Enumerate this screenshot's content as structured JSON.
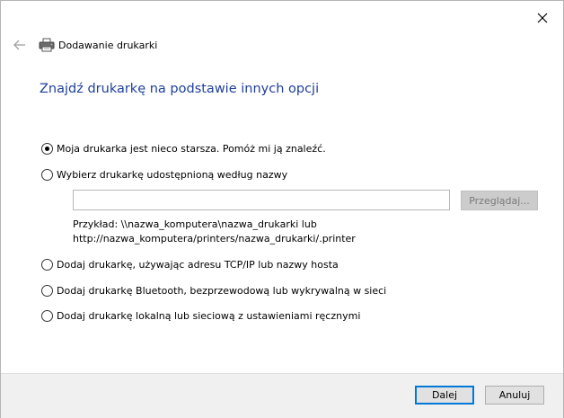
{
  "window": {
    "title": "Dodawanie drukarki",
    "close_icon": "close-icon",
    "back_icon": "back-arrow-icon",
    "printer_icon": "printer-icon"
  },
  "heading": "Znajdź drukarkę na podstawie innych opcji",
  "options": [
    {
      "label": "Moja drukarka jest nieco starsza. Pomóż mi ją znaleźć.",
      "checked": true
    },
    {
      "label": "Wybierz drukarkę udostępnioną według nazwy",
      "checked": false
    },
    {
      "label": "Dodaj drukarkę, używając adresu TCP/IP lub nazwy hosta",
      "checked": false
    },
    {
      "label": "Dodaj drukarkę Bluetooth, bezprzewodową lub wykrywalną w sieci",
      "checked": false
    },
    {
      "label": "Dodaj drukarkę lokalną lub sieciową z ustawieniami ręcznymi",
      "checked": false
    }
  ],
  "shared_printer": {
    "input_value": "",
    "browse_label": "Przeglądaj...",
    "example_line1": "Przykład: \\\\nazwa_komputera\\nazwa_drukarki lub",
    "example_line2": "http://nazwa_komputera/printers/nazwa_drukarki/.printer"
  },
  "footer": {
    "next_label": "Dalej",
    "cancel_label": "Anuluj"
  },
  "colors": {
    "heading": "#1e3f9a",
    "default_button_border": "#0078d7"
  }
}
